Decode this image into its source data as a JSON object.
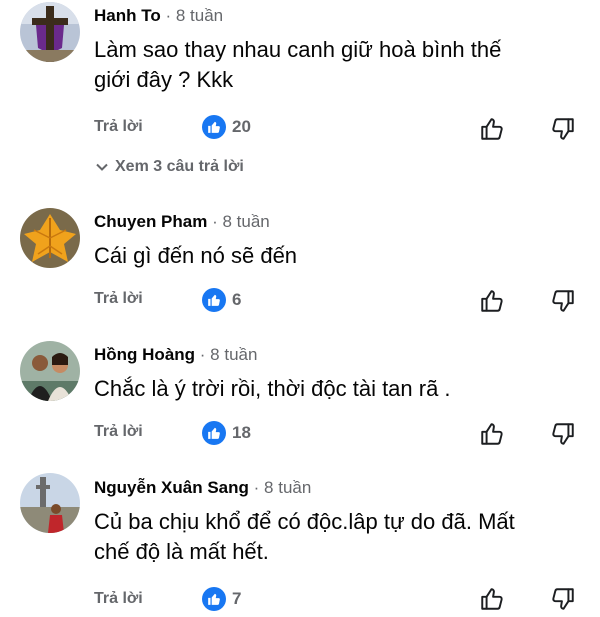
{
  "comments": [
    {
      "author": "Hanh To",
      "time": "· 8 tuần",
      "text_lines": [
        "Làm sao thay nhau canh giữ hoà bình thế",
        "giới đây ? Kkk"
      ],
      "reply_label": "Trả lời",
      "likes": "20",
      "see_replies": "Xem 3 câu trả lời"
    },
    {
      "author": "Chuyen Pham",
      "time": "· 8 tuần",
      "text_lines": [
        "Cái gì đến nó sẽ đến"
      ],
      "reply_label": "Trả lời",
      "likes": "6"
    },
    {
      "author": "Hồng Hoàng",
      "time": "· 8 tuần",
      "text_lines": [
        "Chắc là ý trời rồi, thời  độc tài tan rã ."
      ],
      "reply_label": "Trả lời",
      "likes": "18"
    },
    {
      "author": "Nguyễn Xuân Sang",
      "time": "· 8 tuần",
      "text_lines": [
        "Củ ba chịu khổ để có độc.lâp tự do đã. Mất",
        "chế độ là mất hết."
      ],
      "reply_label": "Trả lời",
      "likes": "7"
    }
  ],
  "colors": {
    "like_blue": "#1877f2",
    "meta_gray": "#65676b"
  },
  "icons": [
    "like-badge-icon",
    "thumbs-up-icon",
    "thumbs-down-icon",
    "chevron-down-icon"
  ]
}
